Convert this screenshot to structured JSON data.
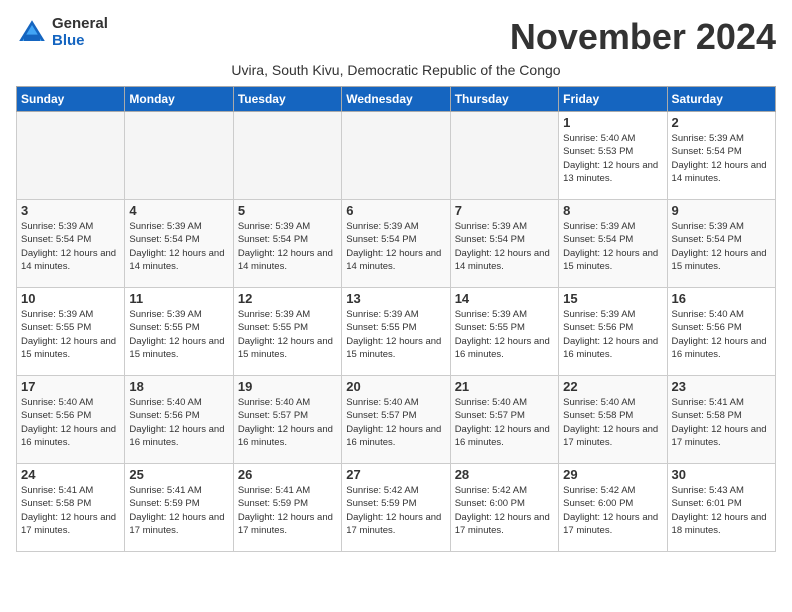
{
  "logo": {
    "general": "General",
    "blue": "Blue"
  },
  "title": "November 2024",
  "subtitle": "Uvira, South Kivu, Democratic Republic of the Congo",
  "days_of_week": [
    "Sunday",
    "Monday",
    "Tuesday",
    "Wednesday",
    "Thursday",
    "Friday",
    "Saturday"
  ],
  "weeks": [
    [
      {
        "day": "",
        "info": ""
      },
      {
        "day": "",
        "info": ""
      },
      {
        "day": "",
        "info": ""
      },
      {
        "day": "",
        "info": ""
      },
      {
        "day": "",
        "info": ""
      },
      {
        "day": "1",
        "info": "Sunrise: 5:40 AM\nSunset: 5:53 PM\nDaylight: 12 hours\nand 13 minutes."
      },
      {
        "day": "2",
        "info": "Sunrise: 5:39 AM\nSunset: 5:54 PM\nDaylight: 12 hours\nand 14 minutes."
      }
    ],
    [
      {
        "day": "3",
        "info": "Sunrise: 5:39 AM\nSunset: 5:54 PM\nDaylight: 12 hours\nand 14 minutes."
      },
      {
        "day": "4",
        "info": "Sunrise: 5:39 AM\nSunset: 5:54 PM\nDaylight: 12 hours\nand 14 minutes."
      },
      {
        "day": "5",
        "info": "Sunrise: 5:39 AM\nSunset: 5:54 PM\nDaylight: 12 hours\nand 14 minutes."
      },
      {
        "day": "6",
        "info": "Sunrise: 5:39 AM\nSunset: 5:54 PM\nDaylight: 12 hours\nand 14 minutes."
      },
      {
        "day": "7",
        "info": "Sunrise: 5:39 AM\nSunset: 5:54 PM\nDaylight: 12 hours\nand 14 minutes."
      },
      {
        "day": "8",
        "info": "Sunrise: 5:39 AM\nSunset: 5:54 PM\nDaylight: 12 hours\nand 15 minutes."
      },
      {
        "day": "9",
        "info": "Sunrise: 5:39 AM\nSunset: 5:54 PM\nDaylight: 12 hours\nand 15 minutes."
      }
    ],
    [
      {
        "day": "10",
        "info": "Sunrise: 5:39 AM\nSunset: 5:55 PM\nDaylight: 12 hours\nand 15 minutes."
      },
      {
        "day": "11",
        "info": "Sunrise: 5:39 AM\nSunset: 5:55 PM\nDaylight: 12 hours\nand 15 minutes."
      },
      {
        "day": "12",
        "info": "Sunrise: 5:39 AM\nSunset: 5:55 PM\nDaylight: 12 hours\nand 15 minutes."
      },
      {
        "day": "13",
        "info": "Sunrise: 5:39 AM\nSunset: 5:55 PM\nDaylight: 12 hours\nand 15 minutes."
      },
      {
        "day": "14",
        "info": "Sunrise: 5:39 AM\nSunset: 5:55 PM\nDaylight: 12 hours\nand 16 minutes."
      },
      {
        "day": "15",
        "info": "Sunrise: 5:39 AM\nSunset: 5:56 PM\nDaylight: 12 hours\nand 16 minutes."
      },
      {
        "day": "16",
        "info": "Sunrise: 5:40 AM\nSunset: 5:56 PM\nDaylight: 12 hours\nand 16 minutes."
      }
    ],
    [
      {
        "day": "17",
        "info": "Sunrise: 5:40 AM\nSunset: 5:56 PM\nDaylight: 12 hours\nand 16 minutes."
      },
      {
        "day": "18",
        "info": "Sunrise: 5:40 AM\nSunset: 5:56 PM\nDaylight: 12 hours\nand 16 minutes."
      },
      {
        "day": "19",
        "info": "Sunrise: 5:40 AM\nSunset: 5:57 PM\nDaylight: 12 hours\nand 16 minutes."
      },
      {
        "day": "20",
        "info": "Sunrise: 5:40 AM\nSunset: 5:57 PM\nDaylight: 12 hours\nand 16 minutes."
      },
      {
        "day": "21",
        "info": "Sunrise: 5:40 AM\nSunset: 5:57 PM\nDaylight: 12 hours\nand 16 minutes."
      },
      {
        "day": "22",
        "info": "Sunrise: 5:40 AM\nSunset: 5:58 PM\nDaylight: 12 hours\nand 17 minutes."
      },
      {
        "day": "23",
        "info": "Sunrise: 5:41 AM\nSunset: 5:58 PM\nDaylight: 12 hours\nand 17 minutes."
      }
    ],
    [
      {
        "day": "24",
        "info": "Sunrise: 5:41 AM\nSunset: 5:58 PM\nDaylight: 12 hours\nand 17 minutes."
      },
      {
        "day": "25",
        "info": "Sunrise: 5:41 AM\nSunset: 5:59 PM\nDaylight: 12 hours\nand 17 minutes."
      },
      {
        "day": "26",
        "info": "Sunrise: 5:41 AM\nSunset: 5:59 PM\nDaylight: 12 hours\nand 17 minutes."
      },
      {
        "day": "27",
        "info": "Sunrise: 5:42 AM\nSunset: 5:59 PM\nDaylight: 12 hours\nand 17 minutes."
      },
      {
        "day": "28",
        "info": "Sunrise: 5:42 AM\nSunset: 6:00 PM\nDaylight: 12 hours\nand 17 minutes."
      },
      {
        "day": "29",
        "info": "Sunrise: 5:42 AM\nSunset: 6:00 PM\nDaylight: 12 hours\nand 17 minutes."
      },
      {
        "day": "30",
        "info": "Sunrise: 5:43 AM\nSunset: 6:01 PM\nDaylight: 12 hours\nand 18 minutes."
      }
    ]
  ]
}
